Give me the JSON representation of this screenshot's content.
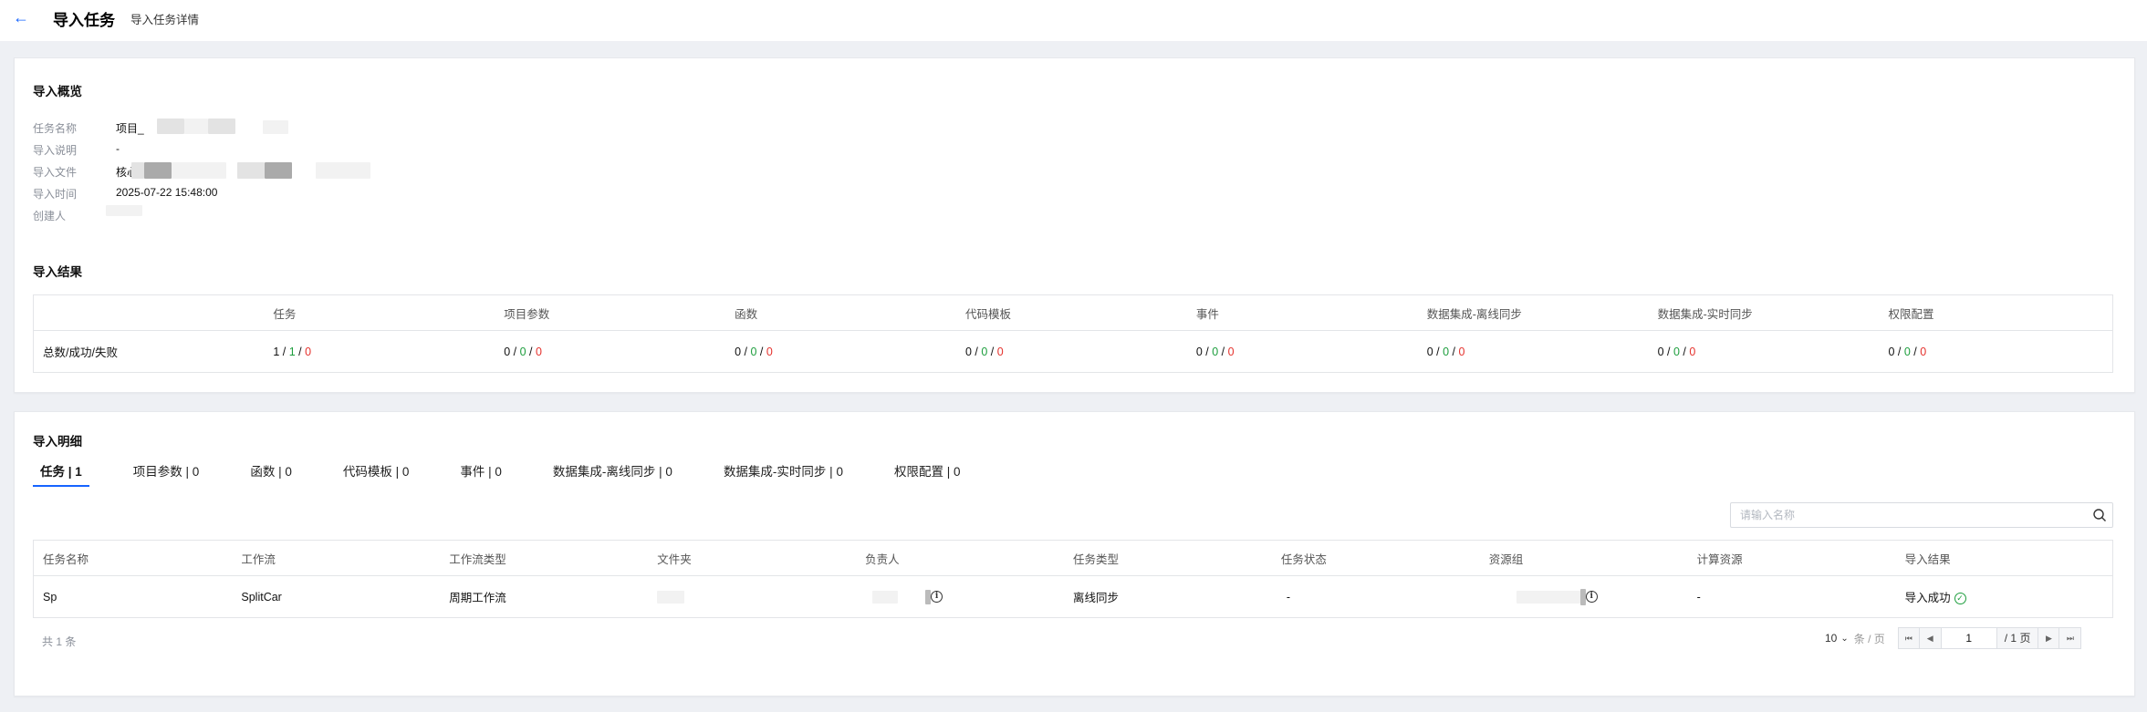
{
  "header": {
    "back_icon": "arrow-left-icon",
    "title": "导入任务",
    "subtitle": "导入任务详情"
  },
  "overview": {
    "title": "导入概览",
    "fields": [
      {
        "label": "任务名称",
        "value": "项目_"
      },
      {
        "label": "导入说明",
        "value": "-"
      },
      {
        "label": "导入文件",
        "value": "核心"
      },
      {
        "label": "导入时间",
        "value": "2025-07-22 15:48:00"
      },
      {
        "label": "创建人",
        "value": ""
      }
    ]
  },
  "result": {
    "title": "导入结果",
    "columns": [
      "",
      "任务",
      "项目参数",
      "函数",
      "代码模板",
      "事件",
      "数据集成-离线同步",
      "数据集成-实时同步",
      "权限配置"
    ],
    "row_label": "总数/成功/失败",
    "cells": [
      {
        "total": "1",
        "success": "1",
        "fail": "0"
      },
      {
        "total": "0",
        "success": "0",
        "fail": "0"
      },
      {
        "total": "0",
        "success": "0",
        "fail": "0"
      },
      {
        "total": "0",
        "success": "0",
        "fail": "0"
      },
      {
        "total": "0",
        "success": "0",
        "fail": "0"
      },
      {
        "total": "0",
        "success": "0",
        "fail": "0"
      },
      {
        "total": "0",
        "success": "0",
        "fail": "0"
      },
      {
        "total": "0",
        "success": "0",
        "fail": "0"
      }
    ]
  },
  "detail": {
    "title": "导入明细",
    "tabs": [
      "任务 | 1",
      "项目参数 | 0",
      "函数 | 0",
      "代码模板 | 0",
      "事件 | 0",
      "数据集成-离线同步 | 0",
      "数据集成-实时同步 | 0",
      "权限配置 | 0"
    ],
    "active_tab": 0,
    "search_placeholder": "请输入名称",
    "columns": [
      "任务名称",
      "工作流",
      "工作流类型",
      "文件夹",
      "负责人",
      "任务类型",
      "任务状态",
      "资源组",
      "计算资源",
      "导入结果"
    ],
    "rows": [
      {
        "name": "Sp",
        "workflow": "SplitCar",
        "workflow_type": "周期工作流",
        "folder": "",
        "owner": "",
        "task_type": "离线同步",
        "task_status": "-",
        "resource_group": "",
        "compute": "-",
        "result": "导入成功"
      }
    ],
    "total_text": "共 1 条",
    "page_size": "10",
    "page_size_unit": "条 / 页",
    "current_page": "1",
    "total_pages": "/ 1 页"
  },
  "colors": {
    "primary": "#1664ff",
    "success": "#1e9e3e",
    "fail": "#e5322d"
  }
}
